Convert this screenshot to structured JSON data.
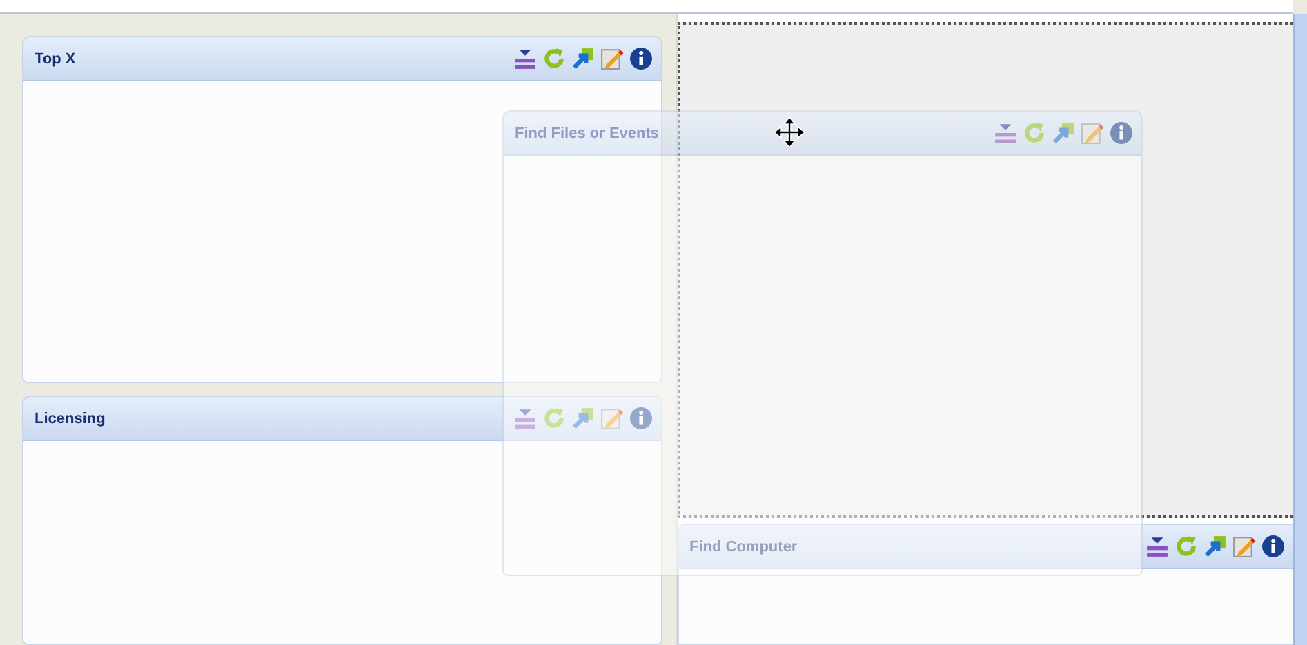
{
  "columns": [
    {
      "drop_placeholder": false,
      "panels": [
        {
          "title": "Top X"
        },
        {
          "title": "Licensing"
        }
      ]
    },
    {
      "drop_placeholder": true,
      "panels": [
        {
          "title": "Find Computer"
        }
      ]
    }
  ],
  "dragged_panel": {
    "title": "Find Files or Events"
  }
}
